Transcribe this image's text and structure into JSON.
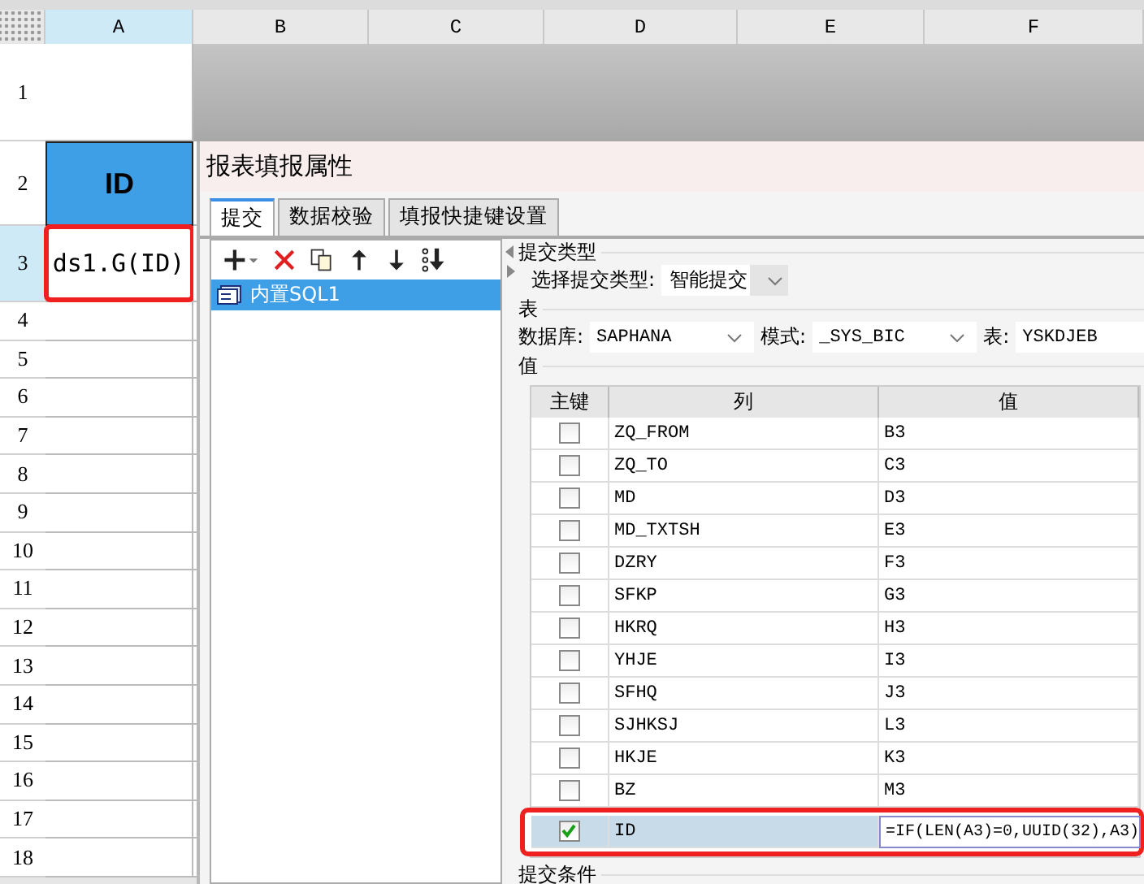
{
  "spreadsheet": {
    "columns": [
      {
        "label": "A",
        "selected": true
      },
      {
        "label": "B",
        "selected": false
      },
      {
        "label": "C",
        "selected": false
      },
      {
        "label": "D",
        "selected": false
      },
      {
        "label": "E",
        "selected": false
      },
      {
        "label": "F",
        "selected": false
      }
    ],
    "rows": [
      {
        "number": "1",
        "selected": false
      },
      {
        "number": "2",
        "selected": false,
        "cell_a": "ID",
        "kind": "header"
      },
      {
        "number": "3",
        "selected": true,
        "cell_a": "ds1.G(ID)",
        "kind": "formula",
        "highlighted": true
      },
      {
        "number": "4",
        "selected": false
      },
      {
        "number": "5",
        "selected": false
      },
      {
        "number": "6",
        "selected": false
      },
      {
        "number": "7",
        "selected": false
      },
      {
        "number": "8",
        "selected": false
      },
      {
        "number": "9",
        "selected": false
      },
      {
        "number": "10",
        "selected": false
      },
      {
        "number": "11",
        "selected": false
      },
      {
        "number": "12",
        "selected": false
      },
      {
        "number": "13",
        "selected": false
      },
      {
        "number": "14",
        "selected": false
      },
      {
        "number": "15",
        "selected": false
      },
      {
        "number": "16",
        "selected": false
      },
      {
        "number": "17",
        "selected": false
      },
      {
        "number": "18",
        "selected": false
      }
    ]
  },
  "dialog": {
    "title": "报表填报属性",
    "tabs": [
      {
        "label": "提交",
        "selected": true
      },
      {
        "label": "数据校验",
        "selected": false
      },
      {
        "label": "填报快捷键设置",
        "selected": false
      }
    ],
    "list_items": [
      {
        "label": "内置SQL1",
        "selected": true
      }
    ],
    "submit_type": {
      "group": "提交类型",
      "label": "选择提交类型:",
      "value": "智能提交"
    },
    "table_group": {
      "group": "表",
      "database_label": "数据库:",
      "database": "SAPHANA",
      "schema_label": "模式:",
      "schema": "_SYS_BIC",
      "table_label": "表:",
      "table": "YSKDJEB"
    },
    "values": {
      "group": "值",
      "columns": [
        "主键",
        "列",
        "值"
      ],
      "rows": [
        {
          "key": false,
          "column": "ZQ_FROM",
          "value": "B3",
          "selected": false
        },
        {
          "key": false,
          "column": "ZQ_TO",
          "value": "C3",
          "selected": false
        },
        {
          "key": false,
          "column": "MD",
          "value": "D3",
          "selected": false
        },
        {
          "key": false,
          "column": "MD_TXTSH",
          "value": "E3",
          "selected": false
        },
        {
          "key": false,
          "column": "DZRY",
          "value": "F3",
          "selected": false
        },
        {
          "key": false,
          "column": "SFKP",
          "value": "G3",
          "selected": false
        },
        {
          "key": false,
          "column": "HKRQ",
          "value": "H3",
          "selected": false
        },
        {
          "key": false,
          "column": "YHJE",
          "value": "I3",
          "selected": false
        },
        {
          "key": false,
          "column": "SFHQ",
          "value": "J3",
          "selected": false
        },
        {
          "key": false,
          "column": "SJHKSJ",
          "value": "L3",
          "selected": false
        },
        {
          "key": false,
          "column": "HKJE",
          "value": "K3",
          "selected": false
        },
        {
          "key": false,
          "column": "BZ",
          "value": "M3",
          "selected": false
        },
        {
          "key": true,
          "column": "ID",
          "value": "=IF(LEN(A3)=0,UUID(32),A3)",
          "selected": true,
          "highlighted": true
        }
      ]
    },
    "condition_group": "提交条件"
  }
}
